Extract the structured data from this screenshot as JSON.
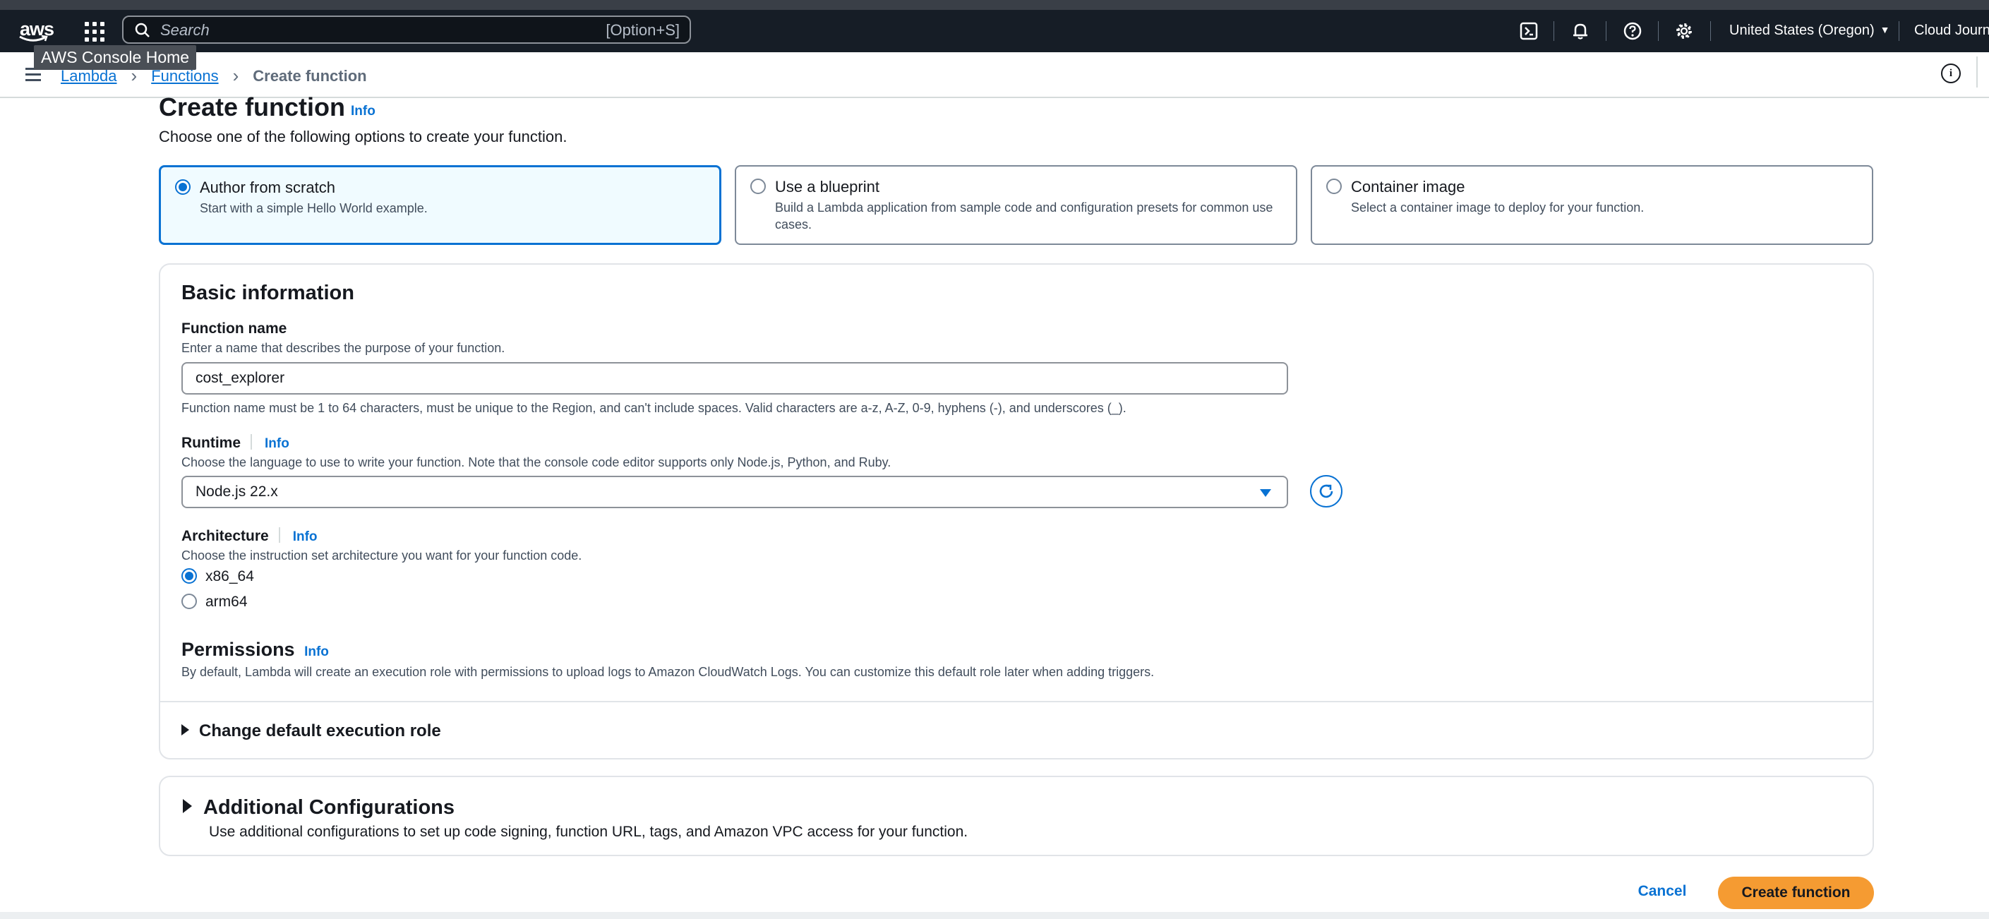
{
  "header": {
    "logo_text": "aws",
    "search_placeholder": "Search",
    "search_shortcut": "[Option+S]",
    "region": "United States (Oregon)",
    "account": "Cloud Journe"
  },
  "tooltip": "AWS Console Home",
  "breadcrumb": {
    "items": [
      "Lambda",
      "Functions"
    ],
    "current": "Create function"
  },
  "page": {
    "title": "Create function",
    "info": "Info",
    "description": "Choose one of the following options to create your function."
  },
  "options": [
    {
      "title": "Author from scratch",
      "desc": "Start with a simple Hello World example.",
      "selected": true
    },
    {
      "title": "Use a blueprint",
      "desc": "Build a Lambda application from sample code and configuration presets for common use cases.",
      "selected": false
    },
    {
      "title": "Container image",
      "desc": "Select a container image to deploy for your function.",
      "selected": false
    }
  ],
  "basic": {
    "title": "Basic information",
    "function_name": {
      "label": "Function name",
      "desc": "Enter a name that describes the purpose of your function.",
      "value": "cost_explorer",
      "constraint": "Function name must be 1 to 64 characters, must be unique to the Region, and can't include spaces. Valid characters are a-z, A-Z, 0-9, hyphens (-), and underscores (_)."
    },
    "runtime": {
      "label": "Runtime",
      "info": "Info",
      "desc": "Choose the language to use to write your function. Note that the console code editor supports only Node.js, Python, and Ruby.",
      "value": "Node.js 22.x"
    },
    "architecture": {
      "label": "Architecture",
      "info": "Info",
      "desc": "Choose the instruction set architecture you want for your function code.",
      "options": [
        "x86_64",
        "arm64"
      ],
      "selected": "x86_64"
    },
    "permissions": {
      "label": "Permissions",
      "info": "Info",
      "desc": "By default, Lambda will create an execution role with permissions to upload logs to Amazon CloudWatch Logs. You can customize this default role later when adding triggers."
    },
    "change_role": "Change default execution role"
  },
  "additional": {
    "title": "Additional Configurations",
    "desc": "Use additional configurations to set up code signing, function URL, tags, and Amazon VPC access for your function."
  },
  "footer": {
    "cancel": "Cancel",
    "create": "Create function"
  },
  "colors": {
    "header_bg": "#161d26",
    "link": "#0972d3",
    "primary_button": "#f59b32",
    "selected_tile_bg": "#f0fbff"
  }
}
